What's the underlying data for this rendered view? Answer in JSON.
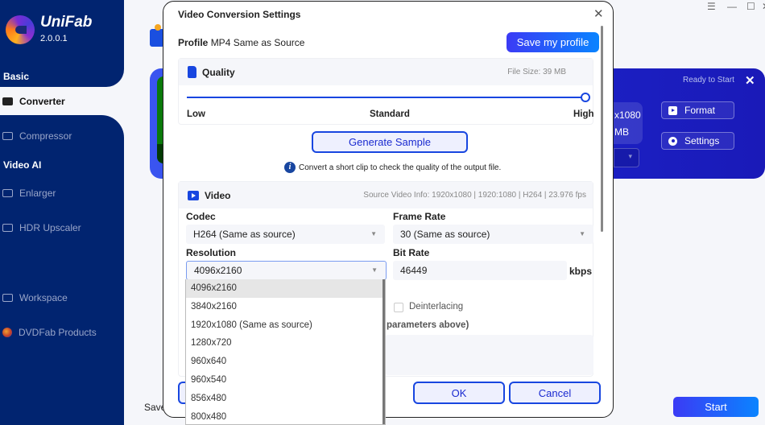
{
  "app": {
    "name": "UniFab",
    "version": "2.0.0.1"
  },
  "window_controls": {
    "menu": "☰",
    "minimize": "—",
    "maximize": "☐",
    "close": "✕"
  },
  "sidebar": {
    "sections": [
      {
        "label": "Basic"
      },
      {
        "label": "Video AI"
      }
    ],
    "items": [
      {
        "label": "Converter",
        "icon": "converter-icon",
        "active": true
      },
      {
        "label": "Compressor",
        "icon": "compressor-icon"
      },
      {
        "label": "Enlarger",
        "icon": "enlarger-icon"
      },
      {
        "label": "HDR Upscaler",
        "icon": "hdr-icon"
      },
      {
        "label": "Workspace",
        "icon": "monitor-icon"
      },
      {
        "label": "DVDFab Products",
        "icon": "dvdfab-icon"
      }
    ]
  },
  "task_card": {
    "status": "Ready to Start",
    "close": "✕",
    "resolution_partial": "x1080",
    "size_partial": "MB",
    "format_label": "Format",
    "settings_label": "Settings"
  },
  "footer": {
    "save_to_partial": "Save",
    "start_label": "Start"
  },
  "dialog": {
    "title": "Video Conversion Settings",
    "close": "✕",
    "profile_label": "Profile",
    "profile_value": "MP4 Same as Source",
    "save_profile_label": "Save my profile",
    "quality": {
      "title": "Quality",
      "file_size": "File Size:  39 MB",
      "slider_labels": [
        "Low",
        "Standard",
        "High"
      ],
      "slider_value": "High",
      "slider_fraction": 1.0,
      "generate_sample_label": "Generate Sample",
      "hint": "Convert a short clip to check the quality of the output file.",
      "hint_icon": "i"
    },
    "video": {
      "title": "Video",
      "source_info": "Source Video Info: 1920x1080 | 1920:1080 | H264 | 23.976 fps",
      "codec_label": "Codec",
      "codec_value": "H264 (Same as source)",
      "frame_rate_label": "Frame Rate",
      "frame_rate_value": "30 (Same as source)",
      "resolution_label": "Resolution",
      "resolution_value": "4096x2160",
      "bit_rate_label": "Bit Rate",
      "bit_rate_value": "46449",
      "bit_rate_unit": "kbps",
      "deinterlacing_label": "Deinterlacing",
      "deinterlacing_checked": false,
      "params_label_partial": "parameters above)",
      "resolution_options": [
        "4096x2160",
        "3840x2160",
        "1920x1080 (Same as source)",
        "1280x720",
        "960x640",
        "960x540",
        "856x480",
        "800x480"
      ]
    },
    "ok_label": "OK",
    "cancel_label": "Cancel"
  }
}
